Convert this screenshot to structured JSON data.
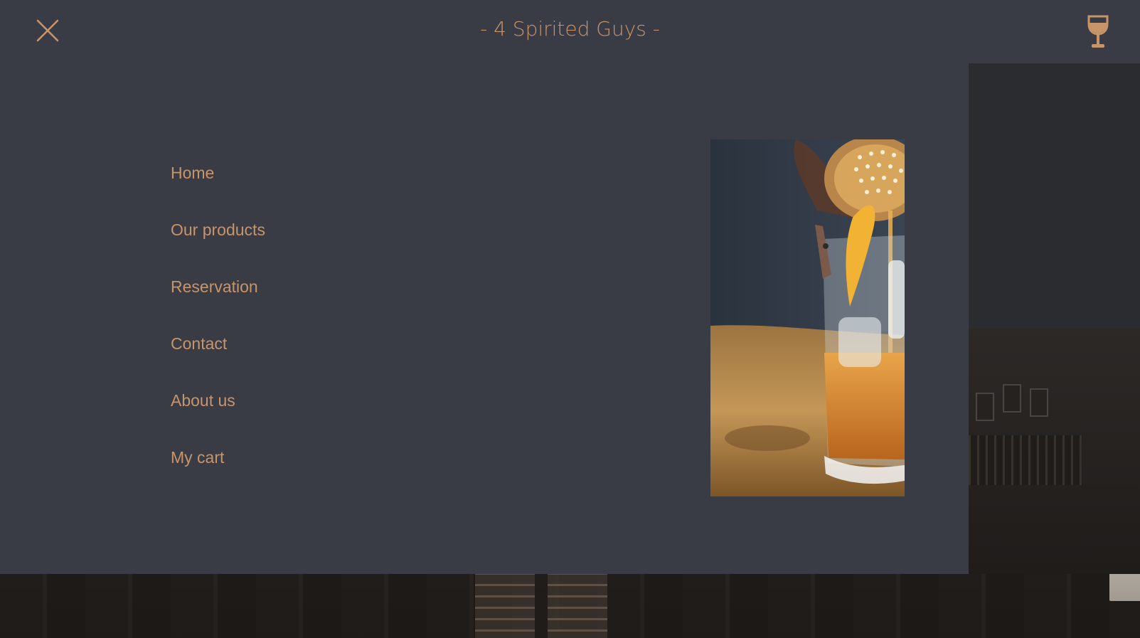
{
  "header": {
    "brand_title": "- 4 Spirited Guys -",
    "close_icon": "close-icon",
    "cart_icon": "wine-glass-icon"
  },
  "menu": {
    "items": [
      {
        "label": "Home"
      },
      {
        "label": "Our products"
      },
      {
        "label": "Reservation"
      },
      {
        "label": "Contact"
      },
      {
        "label": "About us"
      },
      {
        "label": "My cart"
      }
    ],
    "image": "cocktail-photo"
  },
  "colors": {
    "accent": "#c8946a",
    "panel": "#393b45"
  }
}
